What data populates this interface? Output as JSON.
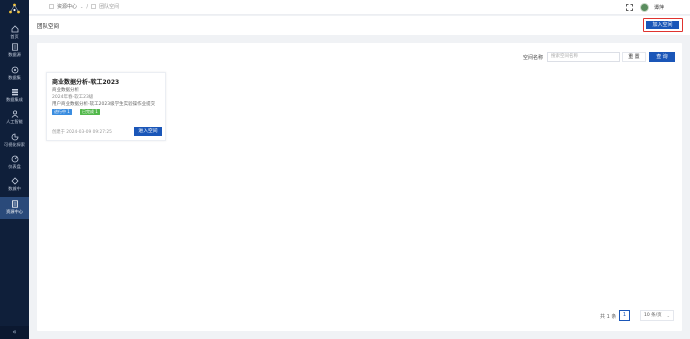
{
  "sidebar": {
    "items": [
      {
        "label": "首页",
        "icon": "home-icon"
      },
      {
        "label": "数据源",
        "icon": "database-icon"
      },
      {
        "label": "数据集",
        "icon": "dataset-icon"
      },
      {
        "label": "数据集成",
        "icon": "integration-icon"
      },
      {
        "label": "人工智能",
        "icon": "ai-icon"
      },
      {
        "label": "可视化探索",
        "icon": "chart-icon"
      },
      {
        "label": "仪表盘",
        "icon": "dashboard-icon"
      },
      {
        "label": "数據中",
        "icon": "data-center-icon"
      },
      {
        "label": "资源中心",
        "icon": "resource-icon"
      }
    ],
    "active_index": 8,
    "collapse_glyph": "«"
  },
  "header": {
    "breadcrumb": [
      "资源中心",
      "团队空间"
    ],
    "breadcrumb_separator": "/",
    "user_name": "谭萍"
  },
  "subheader": {
    "title": "团队空间",
    "join_button": "加入空间"
  },
  "filter": {
    "label": "空间名称",
    "placeholder": "搜索空间名称",
    "reset": "重 置",
    "query": "查 询"
  },
  "card": {
    "title": "商业数据分析-软工2023",
    "subtitle": "商业数据分析",
    "term": "2024年春-软工23级",
    "description": "用户商业数据分析-软工2023级学生实验操作业提交",
    "tag_progress": "进行中 1",
    "tag_finished": "已完成 1",
    "created": "创建于 2024-03-09 09:27:25",
    "enter_button": "进入空间"
  },
  "pagination": {
    "total": "共 1 条",
    "current_page": "1",
    "page_size": "10 条/页"
  },
  "colors": {
    "sidebar_bg": "#0f1f3a",
    "primary": "#1a56b8",
    "highlight_border": "#e0342f",
    "tag_progress": "#3a8de0",
    "tag_finished": "#52b84b"
  }
}
